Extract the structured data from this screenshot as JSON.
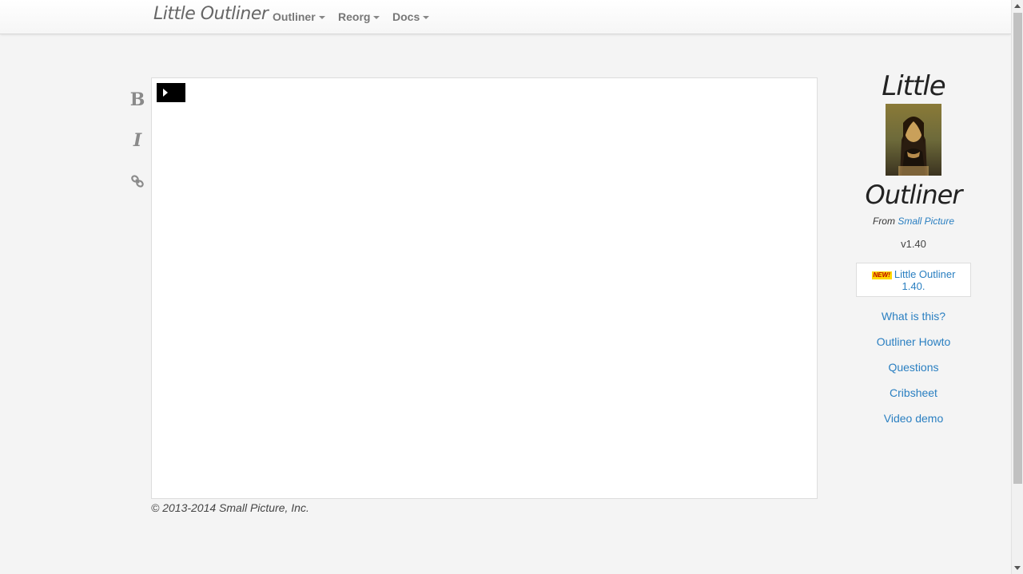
{
  "navbar": {
    "brand": "Little Outliner",
    "menus": [
      {
        "label": "Outliner"
      },
      {
        "label": "Reorg"
      },
      {
        "label": "Docs"
      }
    ]
  },
  "toolbar": {
    "bold_label": "B",
    "italic_label": "I",
    "icons": [
      "bold-icon",
      "italic-icon",
      "link-icon"
    ]
  },
  "footer": {
    "copyright": "© 2013-2014 Small Picture, Inc."
  },
  "sidebar": {
    "logo_top": "Little",
    "logo_bottom": "Outliner",
    "from_prefix": "From ",
    "from_link": "Small Picture",
    "version": "v1.40",
    "news_badge": "NEW!",
    "news_link": "Little Outliner 1.40.",
    "links": [
      {
        "label": "What is this?"
      },
      {
        "label": "Outliner Howto"
      },
      {
        "label": "Questions"
      },
      {
        "label": "Cribsheet"
      },
      {
        "label": "Video demo"
      }
    ]
  },
  "colors": {
    "link": "#2a7fc1",
    "background": "#f4f4f4",
    "badge": "#ffd700"
  }
}
